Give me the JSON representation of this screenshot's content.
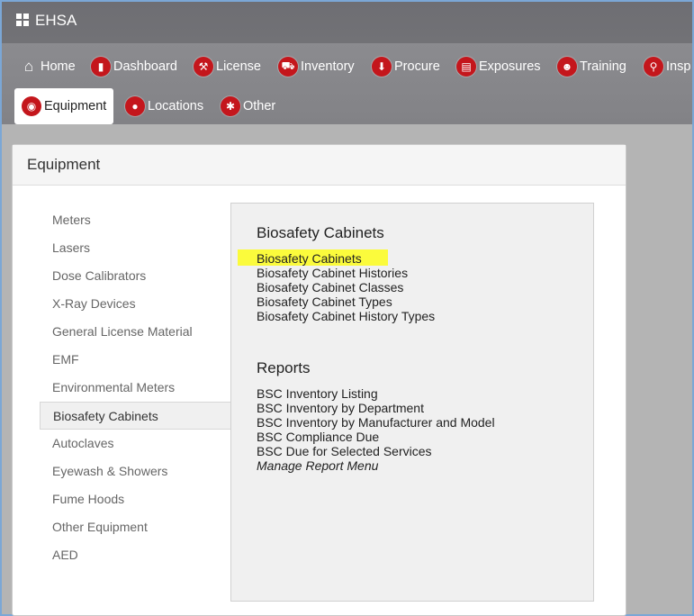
{
  "app": {
    "title": "EHSA"
  },
  "nav": {
    "row1": [
      {
        "label": "Home",
        "icon": "home-icon"
      },
      {
        "label": "Dashboard",
        "icon": "bar-chart-icon"
      },
      {
        "label": "License",
        "icon": "wrench-icon"
      },
      {
        "label": "Inventory",
        "icon": "truck-icon"
      },
      {
        "label": "Procure",
        "icon": "arrow-down-icon"
      },
      {
        "label": "Exposures",
        "icon": "clipboard-icon"
      },
      {
        "label": "Training",
        "icon": "reader-icon"
      },
      {
        "label": "Insp",
        "icon": "magnifier-icon"
      }
    ],
    "row2": [
      {
        "label": "Equipment",
        "icon": "gauge-icon",
        "active": true
      },
      {
        "label": "Locations",
        "icon": "map-pin-icon"
      },
      {
        "label": "Other",
        "icon": "asterisk-icon"
      }
    ]
  },
  "panel": {
    "title": "Equipment",
    "sidebar": [
      "Meters",
      "Lasers",
      "Dose Calibrators",
      "X-Ray Devices",
      "General License Material",
      "EMF",
      "Environmental Meters",
      "Biosafety Cabinets",
      "Autoclaves",
      "Eyewash & Showers",
      "Fume Hoods",
      "Other Equipment",
      "AED"
    ],
    "selected": "Biosafety Cabinets",
    "content": {
      "section_title": "Biosafety Cabinets",
      "links": [
        "Biosafety Cabinets",
        "Biosafety Cabinet Histories",
        "Biosafety Cabinet Classes",
        "Biosafety Cabinet Types",
        "Biosafety Cabinet History Types"
      ],
      "reports_title": "Reports",
      "reports": [
        "BSC Inventory Listing",
        "BSC Inventory by Department",
        "BSC Inventory by Manufacturer and Model",
        "BSC Compliance Due",
        "BSC Due for Selected Services",
        "Manage Report Menu"
      ]
    }
  },
  "colors": {
    "accent": "#c4161c",
    "highlight": "#fbfb3c",
    "titlebar": "#6e6e73",
    "navbar": "#8b8b8f"
  }
}
